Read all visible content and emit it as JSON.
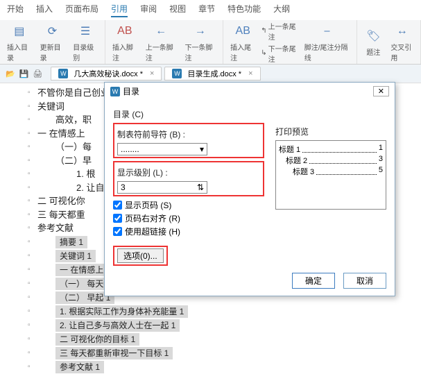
{
  "ribbon_tabs": [
    "开始",
    "插入",
    "页面布局",
    "引用",
    "审阅",
    "视图",
    "章节",
    "特色功能",
    "大纲"
  ],
  "ribbon_active_index": 3,
  "ribbon": {
    "insert_toc": "插入目录",
    "update_toc": "更新目录",
    "toc_level": "目录级别",
    "insert_footnote": "插入脚注",
    "prev_footnote": "上一条脚注",
    "next_footnote": "下一条脚注",
    "insert_endnote": "插入尾注",
    "prev_endnote": "上一条尾注",
    "next_endnote": "下一条尾注",
    "note_sep": "脚注/尾注分隔线",
    "caption": "题注",
    "cross_ref": "交叉引用"
  },
  "qat_tabs": [
    "几大高效秘诀.docx *",
    "目录生成.docx *"
  ],
  "doc_lines": [
    {
      "lvl": 1,
      "text": "不管你是自己创业当老板还是给别人打工，做一个高效的人都是走向职场..."
    },
    {
      "lvl": 1,
      "text": "关键词"
    },
    {
      "lvl": 2,
      "text": "高效，职"
    },
    {
      "lvl": 1,
      "text": "一 在情感上"
    },
    {
      "lvl": 2,
      "text": "（一）每"
    },
    {
      "lvl": 2,
      "text": "（二）早"
    },
    {
      "lvl": 3,
      "text": "1. 根"
    },
    {
      "lvl": 3,
      "text": "2. 让自"
    },
    {
      "lvl": 1,
      "text": "二 可视化你"
    },
    {
      "lvl": 1,
      "text": "三 每天都重"
    },
    {
      "lvl": 1,
      "text": "参考文献"
    }
  ],
  "toc_lines": [
    "摘要    1",
    "关键词    1",
    "一  在情感上认同目标    1",
    "（一） 每天都确定最重要的那件事    1",
    "（二） 早起    1",
    "1. 根据实际工作为身体补充能量    1",
    "2. 让自己多与高效人士在一起    1",
    "二 可视化你的目标    1",
    "三  每天都重新审视一下目标    1",
    "参考文献    1"
  ],
  "dialog": {
    "title": "目录",
    "section": "目录 (C)",
    "leader_label": "制表符前导符 (B) :",
    "leader_value": "........",
    "level_label": "显示级别 (L) :",
    "level_value": "3",
    "show_page": "显示页码 (S)",
    "right_align": "页码右对齐 (R)",
    "use_hyper": "使用超链接 (H)",
    "options": "选项(0)...",
    "preview_label": "打印预览",
    "preview": [
      {
        "t": "标题 1",
        "p": "1"
      },
      {
        "t": "标题 2",
        "p": "3"
      },
      {
        "t": "标题 3",
        "p": "5"
      }
    ],
    "ok": "确定",
    "cancel": "取消"
  }
}
